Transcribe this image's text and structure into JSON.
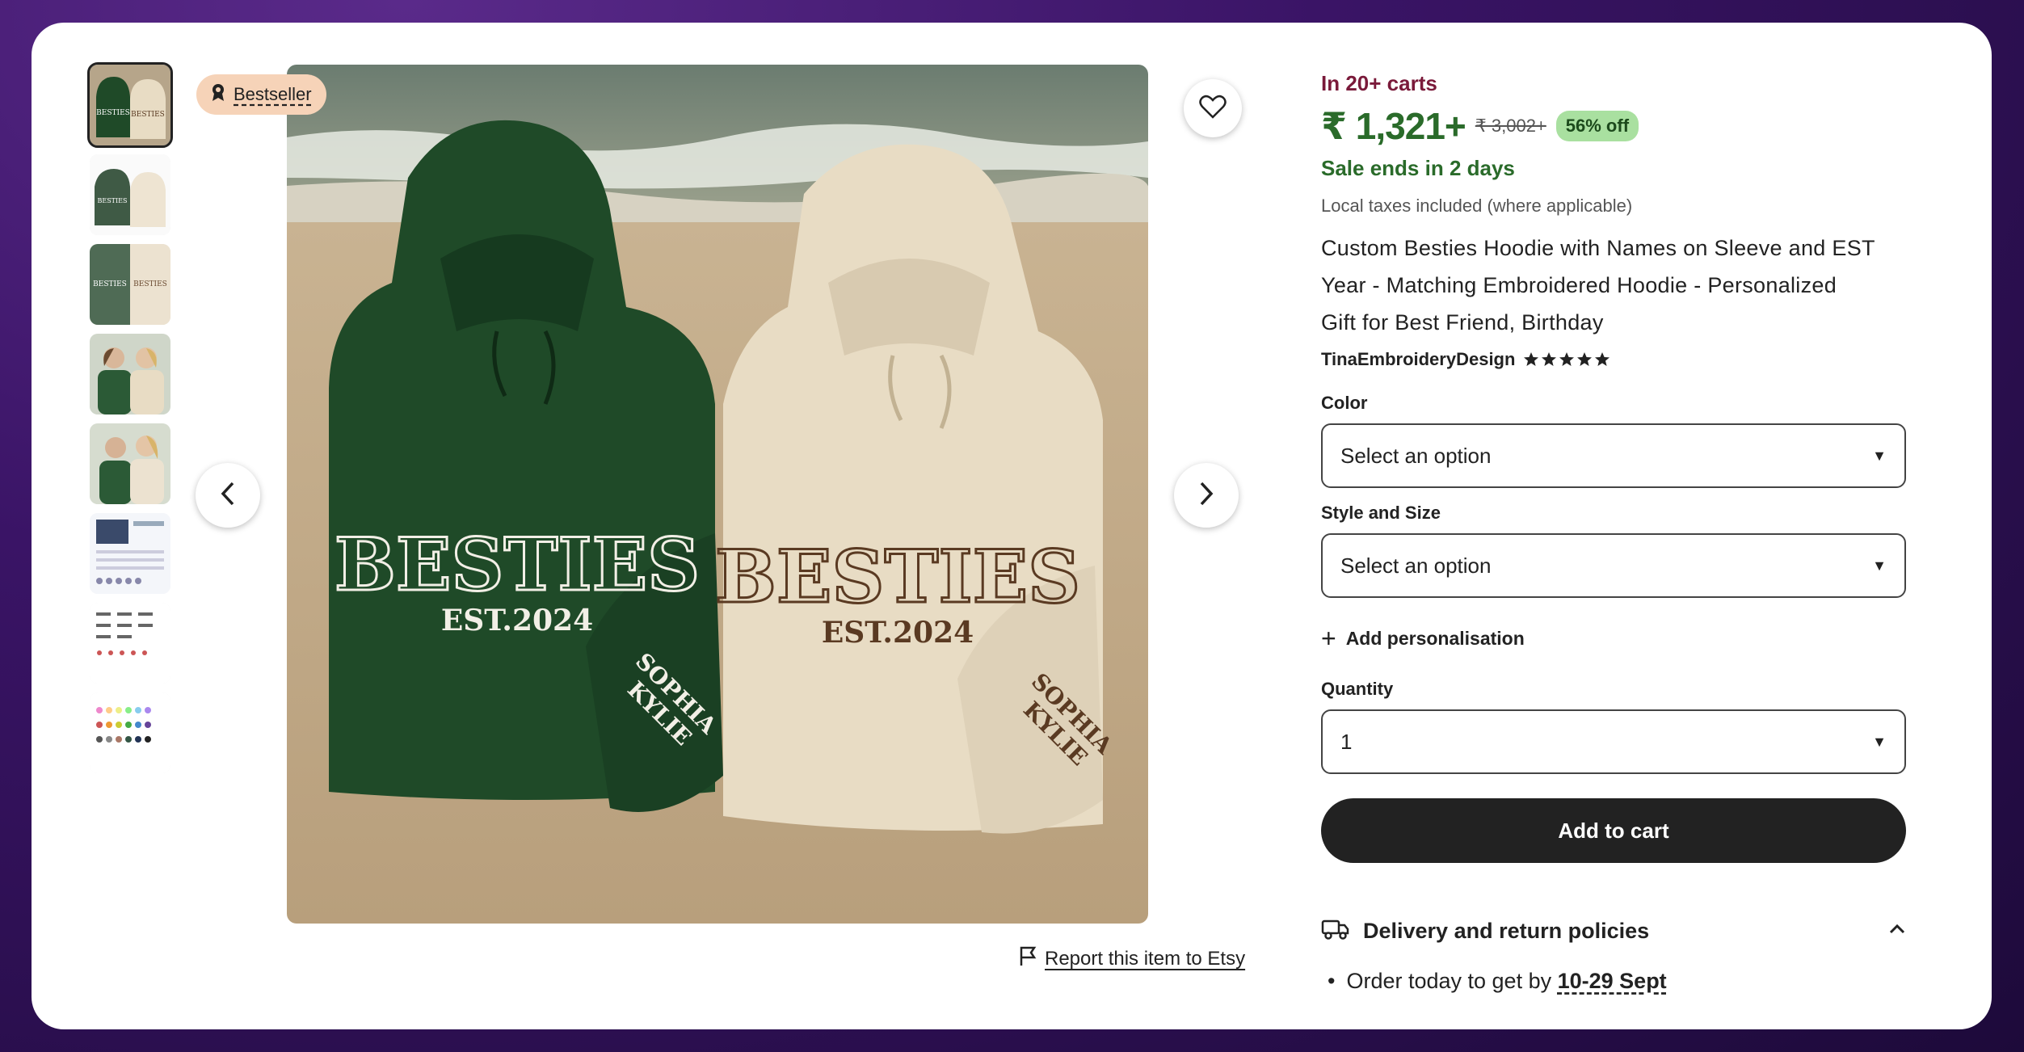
{
  "badge": {
    "label": "Bestseller",
    "icon": "award-icon"
  },
  "thumbnails": [
    {
      "name": "thumb-green-cream-hoodies",
      "active": true
    },
    {
      "name": "thumb-hoodies-flat"
    },
    {
      "name": "thumb-hoodies-closeup"
    },
    {
      "name": "thumb-models-wearing"
    },
    {
      "name": "thumb-models-wearing-2"
    },
    {
      "name": "thumb-size-chart"
    },
    {
      "name": "thumb-font-options"
    },
    {
      "name": "thumb-thread-colors"
    }
  ],
  "product": {
    "carts": "In 20+ carts",
    "price": "₹ 1,321+",
    "old_price": "₹ 3,002+",
    "discount": "56% off",
    "sale_ends": "Sale ends in 2 days",
    "taxes": "Local taxes included (where applicable)",
    "title_lines": [
      "Custom Besties Hoodie with Names on Sleeve and EST",
      "Year - Matching Embroidered Hoodie - Personalized",
      "Gift for Best Friend, Birthday"
    ],
    "shop_name": "TinaEmbroideryDesign",
    "rating_stars": 5
  },
  "options": {
    "color_label": "Color",
    "color_value": "Select an option",
    "style_label": "Style and Size",
    "style_value": "Select an option",
    "add_personalisation": "Add personalisation",
    "quantity_label": "Quantity",
    "quantity_value": "1",
    "add_to_cart": "Add to cart"
  },
  "delivery": {
    "heading": "Delivery and return policies",
    "order_text": "Order today to get by",
    "order_date": "10-29 Sept"
  },
  "report": "Report this item to Etsy",
  "image_text": {
    "word": "BESTIES",
    "est": "EST.2024",
    "sleeve_name_1": "SOPHIA",
    "sleeve_name_2": "KYLIE"
  },
  "colors": {
    "green_hoodie": "#1f4a28",
    "cream_hoodie": "#e8dcc4",
    "price_green": "#2a6b2a",
    "carts_red": "#7a1a3a",
    "badge_bg": "#f6d3b8",
    "discount_bg": "#a9e0a0"
  }
}
